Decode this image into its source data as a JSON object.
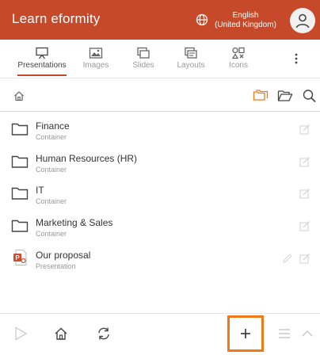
{
  "header": {
    "title": "Learn eformity",
    "language_line1": "English",
    "language_line2": "(United Kingdom)",
    "brand_color": "#c64a2a"
  },
  "tabs": [
    {
      "label": "Presentations",
      "icon": "presentation-icon",
      "active": true
    },
    {
      "label": "Images",
      "icon": "image-icon",
      "active": false
    },
    {
      "label": "Slides",
      "icon": "slides-icon",
      "active": false
    },
    {
      "label": "Layouts",
      "icon": "layouts-icon",
      "active": false
    },
    {
      "label": "Icons",
      "icon": "icons-icon",
      "active": false
    }
  ],
  "items": [
    {
      "name": "Finance",
      "type": "Container",
      "icon": "folder-icon"
    },
    {
      "name": "Human Resources (HR)",
      "type": "Container",
      "icon": "folder-icon"
    },
    {
      "name": "IT",
      "type": "Container",
      "icon": "folder-icon"
    },
    {
      "name": "Marketing & Sales",
      "type": "Container",
      "icon": "folder-icon"
    },
    {
      "name": "Our proposal",
      "type": "Presentation",
      "icon": "powerpoint-icon"
    }
  ],
  "highlight_color": "#f07a16"
}
